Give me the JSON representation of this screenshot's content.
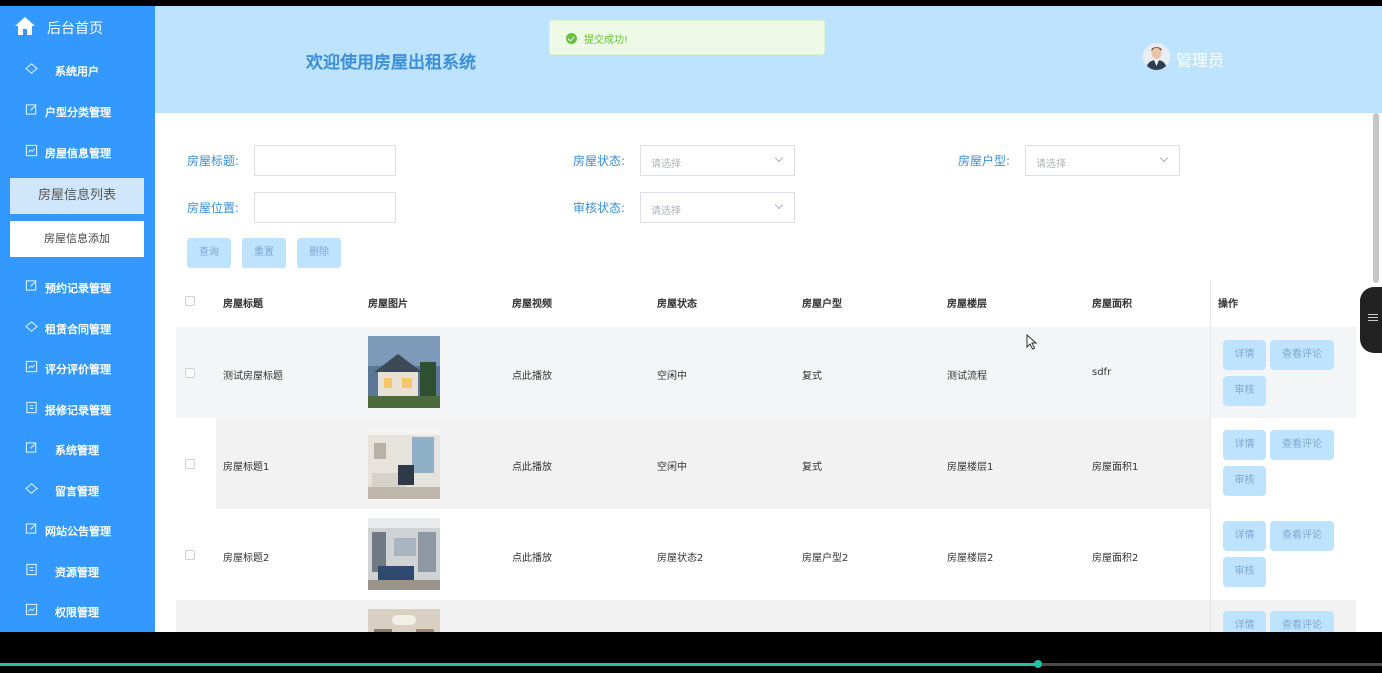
{
  "sidebar": {
    "home": "后台首页",
    "items": [
      {
        "label": "系统用户",
        "icon": "diamond-icon"
      },
      {
        "label": "户型分类管理",
        "icon": "edit-icon"
      },
      {
        "label": "房屋信息管理",
        "icon": "chart-icon"
      },
      {
        "label": "预约记录管理",
        "icon": "edit-icon"
      },
      {
        "label": "租赁合同管理",
        "icon": "diamond-icon"
      },
      {
        "label": "评分评价管理",
        "icon": "chart-icon"
      },
      {
        "label": "报修记录管理",
        "icon": "note-icon"
      },
      {
        "label": "系统管理",
        "icon": "edit-icon"
      },
      {
        "label": "留言管理",
        "icon": "diamond-icon"
      },
      {
        "label": "网站公告管理",
        "icon": "edit-icon"
      },
      {
        "label": "资源管理",
        "icon": "note-icon"
      },
      {
        "label": "权限管理",
        "icon": "chart-icon"
      }
    ],
    "sub_active": "房屋信息列表",
    "sub_normal": "房屋信息添加"
  },
  "header": {
    "title": "欢迎使用房屋出租系统",
    "user": "管理员"
  },
  "toast": {
    "message": "提交成功!"
  },
  "search": {
    "title_label": "房屋标题:",
    "status_label": "房屋状态:",
    "type_label": "房屋户型:",
    "location_label": "房屋位置:",
    "audit_label": "审核状态:",
    "placeholder": "请选择",
    "query": "查询",
    "reset": "重置",
    "delete": "删除"
  },
  "table": {
    "headers": [
      "房屋标题",
      "房屋图片",
      "房屋视频",
      "房屋状态",
      "房屋户型",
      "房屋楼层",
      "房屋面积",
      "操作"
    ],
    "rows": [
      {
        "title": "测试房屋标题",
        "video": "点此播放",
        "status": "空闲中",
        "type": "复式",
        "floor": "测试流程",
        "area": "sdfr"
      },
      {
        "title": "房屋标题1",
        "video": "点此播放",
        "status": "空闲中",
        "type": "复式",
        "floor": "房屋楼层1",
        "area": "房屋面积1"
      },
      {
        "title": "房屋标题2",
        "video": "点此播放",
        "status": "房屋状态2",
        "type": "房屋户型2",
        "floor": "房屋楼层2",
        "area": "房屋面积2"
      }
    ],
    "actions": {
      "detail": "详情",
      "comments": "查看评论",
      "audit": "审核"
    }
  },
  "colors": {
    "sidebar": "#3399ff",
    "header": "#bde3ff",
    "button": "#bde3ff",
    "success": "#67c23a",
    "progress": "#21c2a0"
  },
  "video_progress": 0.75
}
